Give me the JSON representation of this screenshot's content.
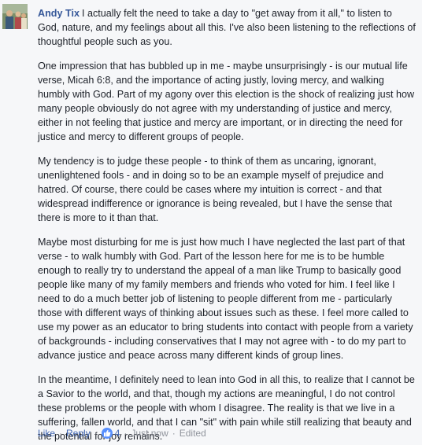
{
  "comment": {
    "author": "Andy Tix",
    "paragraphs": [
      "I actually felt the need to take a day to \"get away from it all,\" to listen to God, nature, and my feelings about all this. I've also been listening to the reflections of thoughtful people such as you.",
      "One impression that has bubbled up in me - maybe unsurprisingly - is our mutual life verse, Micah 6:8, and the importance of acting justly, loving mercy, and walking humbly with God. Part of my agony over this election is the shock of realizing just how many people obviously do not agree with my understanding of justice and mercy, either in not feeling that justice and mercy are important, or in directing the need for justice and mercy to different groups of people.",
      "My tendency is to judge these people - to think of them as uncaring, ignorant, unenlightened fools - and in doing so to be an example myself of prejudice and hatred. Of course, there could be cases where my intuition is correct - and that widespread indifference or ignorance is being revealed, but I have the sense that there is more to it than that.",
      "Maybe most disturbing for me is just how much I have neglected the last part of that verse - to walk humbly with God. Part of the lesson here for me is to be humble enough to really try to understand the appeal of a man like Trump to basically good people like many of my family members and friends who voted for him. I feel like I need to do a much better job of listening to people different from me - particularly those with different ways of thinking about issues such as these. I feel more called to use my power as an educator to bring students into contact with people from a variety of backgrounds - including conservatives that I may not agree with - to do my part to advance justice and peace across many different kinds of group lines.",
      "In the meantime, I definitely need to lean into God in all this, to realize that I cannot be a Savior to the world, and that, though my actions are meaningful, I do not control these problems or the people with whom I disagree. The reality is that we live in a suffering, fallen world, and that I can \"sit\" with pain while still realizing that beauty and the potential for joy remains."
    ]
  },
  "actions": {
    "like_label": "Like",
    "reply_label": "Reply",
    "like_count": "4",
    "timestamp": "Just now",
    "edited_label": "Edited",
    "separator": "·"
  },
  "colors": {
    "author": "#365899",
    "link": "#4267b2",
    "meta": "#90949c",
    "like_badge": "#5890ff"
  },
  "icons": {
    "avatar": "profile-photo",
    "like": "thumbs-up-icon"
  }
}
